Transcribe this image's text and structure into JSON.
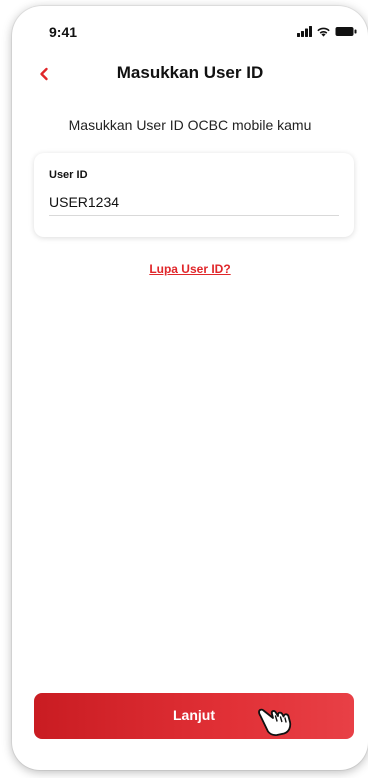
{
  "status_bar": {
    "time": "9:41",
    "icons": [
      "signal-icon",
      "wifi-icon",
      "battery-icon"
    ]
  },
  "header": {
    "back_icon": "chevron-left-icon",
    "title": "Masukkan User ID"
  },
  "subtitle": "Masukkan User ID OCBC mobile kamu",
  "user_id_field": {
    "label": "User ID",
    "value": "USER1234"
  },
  "forgot_link": "Lupa User ID?",
  "primary_button": {
    "label": "Lanjut"
  },
  "pointer_icon": "hand-pointer-icon",
  "colors": {
    "accent": "#e0262a",
    "button_start": "#c91c22",
    "button_end": "#e84046",
    "text": "#111111"
  }
}
